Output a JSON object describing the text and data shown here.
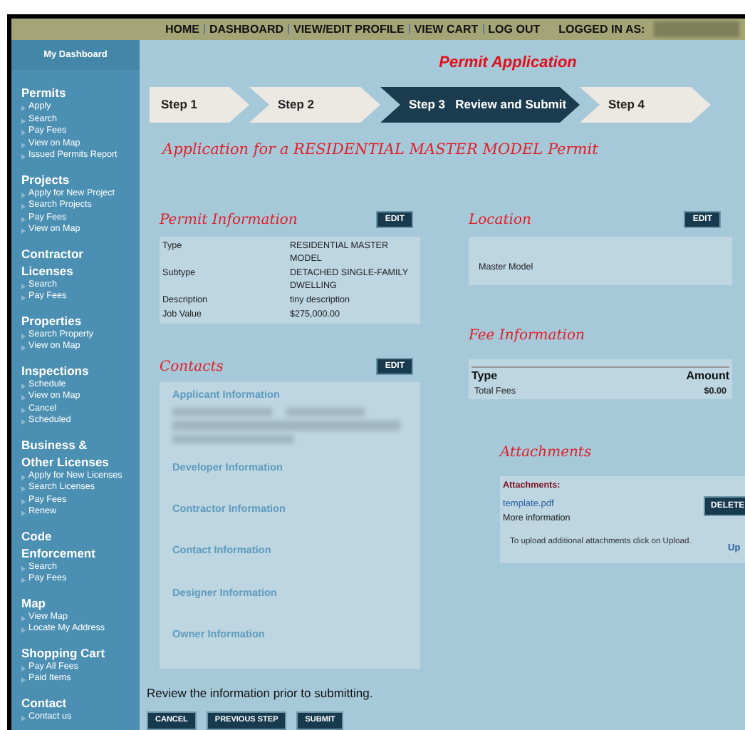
{
  "top_nav": {
    "links": [
      "HOME",
      "DASHBOARD",
      "VIEW/EDIT PROFILE",
      "VIEW CART",
      "LOG OUT"
    ],
    "logged_in_label": "LOGGED IN AS:"
  },
  "sidebar": {
    "dashboard": "My Dashboard",
    "sections": [
      {
        "title": "Permits",
        "items": [
          "Apply",
          "Search",
          "Pay Fees",
          "View on Map",
          "Issued Permits Report"
        ]
      },
      {
        "title": "Projects",
        "items": [
          "Apply for New Project",
          "Search Projects",
          "Pay Fees",
          "View on Map"
        ]
      },
      {
        "title": "Contractor Licenses",
        "items": [
          "Search",
          "Pay Fees"
        ]
      },
      {
        "title": "Properties",
        "items": [
          "Search Property",
          "View on Map"
        ]
      },
      {
        "title": "Inspections",
        "items": [
          "Schedule",
          "View on Map",
          "Cancel",
          "Scheduled"
        ]
      },
      {
        "title": "Business & Other Licenses",
        "items": [
          "Apply for New Licenses",
          "Search Licenses",
          "Pay Fees",
          "Renew"
        ]
      },
      {
        "title": "Code Enforcement",
        "items": [
          "Search",
          "Pay Fees"
        ]
      },
      {
        "title": "Map",
        "items": [
          "View Map",
          "Locate My Address"
        ]
      },
      {
        "title": "Shopping Cart",
        "items": [
          "Pay All Fees",
          "Paid Items"
        ]
      },
      {
        "title": "Contact",
        "items": [
          "Contact us"
        ]
      }
    ]
  },
  "page_title": "Permit Application",
  "steps": [
    {
      "label": "Step 1",
      "selected": false
    },
    {
      "label": "Step 2",
      "selected": false
    },
    {
      "label": "Step 3   Review and Submit",
      "selected": true
    },
    {
      "label": "Step 4",
      "selected": false
    }
  ],
  "heading": "Application for a RESIDENTIAL MASTER MODEL Permit",
  "permit_information": {
    "title": "Permit Information",
    "edit": "EDIT",
    "rows": [
      {
        "label": "Type",
        "value": "RESIDENTIAL MASTER MODEL"
      },
      {
        "label": "Subtype",
        "value": "DETACHED SINGLE-FAMILY DWELLING"
      },
      {
        "label": "Description",
        "value": "tiny description"
      },
      {
        "label": "Job Value",
        "value": "$275,000.00"
      }
    ]
  },
  "contacts": {
    "title": "Contacts",
    "edit": "EDIT",
    "groups": [
      "Applicant Information",
      "Developer Information",
      "Contractor Information",
      "Contact Information",
      "Designer Information",
      "Owner Information"
    ]
  },
  "location": {
    "title": "Location",
    "edit": "EDIT",
    "value": "Master Model"
  },
  "fee_information": {
    "title": "Fee Information",
    "columns": [
      "Type",
      "Amount"
    ],
    "rows": [
      {
        "type": "Total Fees",
        "amount": "$0.00"
      }
    ]
  },
  "attachments": {
    "title": "Attachments",
    "label": "Attachments:",
    "file": "template.pdf",
    "more": "More information",
    "delete": "DELETE",
    "note": "To upload additional attachments click on Upload.",
    "upload": "Up"
  },
  "review_note": "Review the information prior to submitting.",
  "buttons": [
    "CANCEL",
    "PREVIOUS STEP",
    "SUBMIT"
  ]
}
